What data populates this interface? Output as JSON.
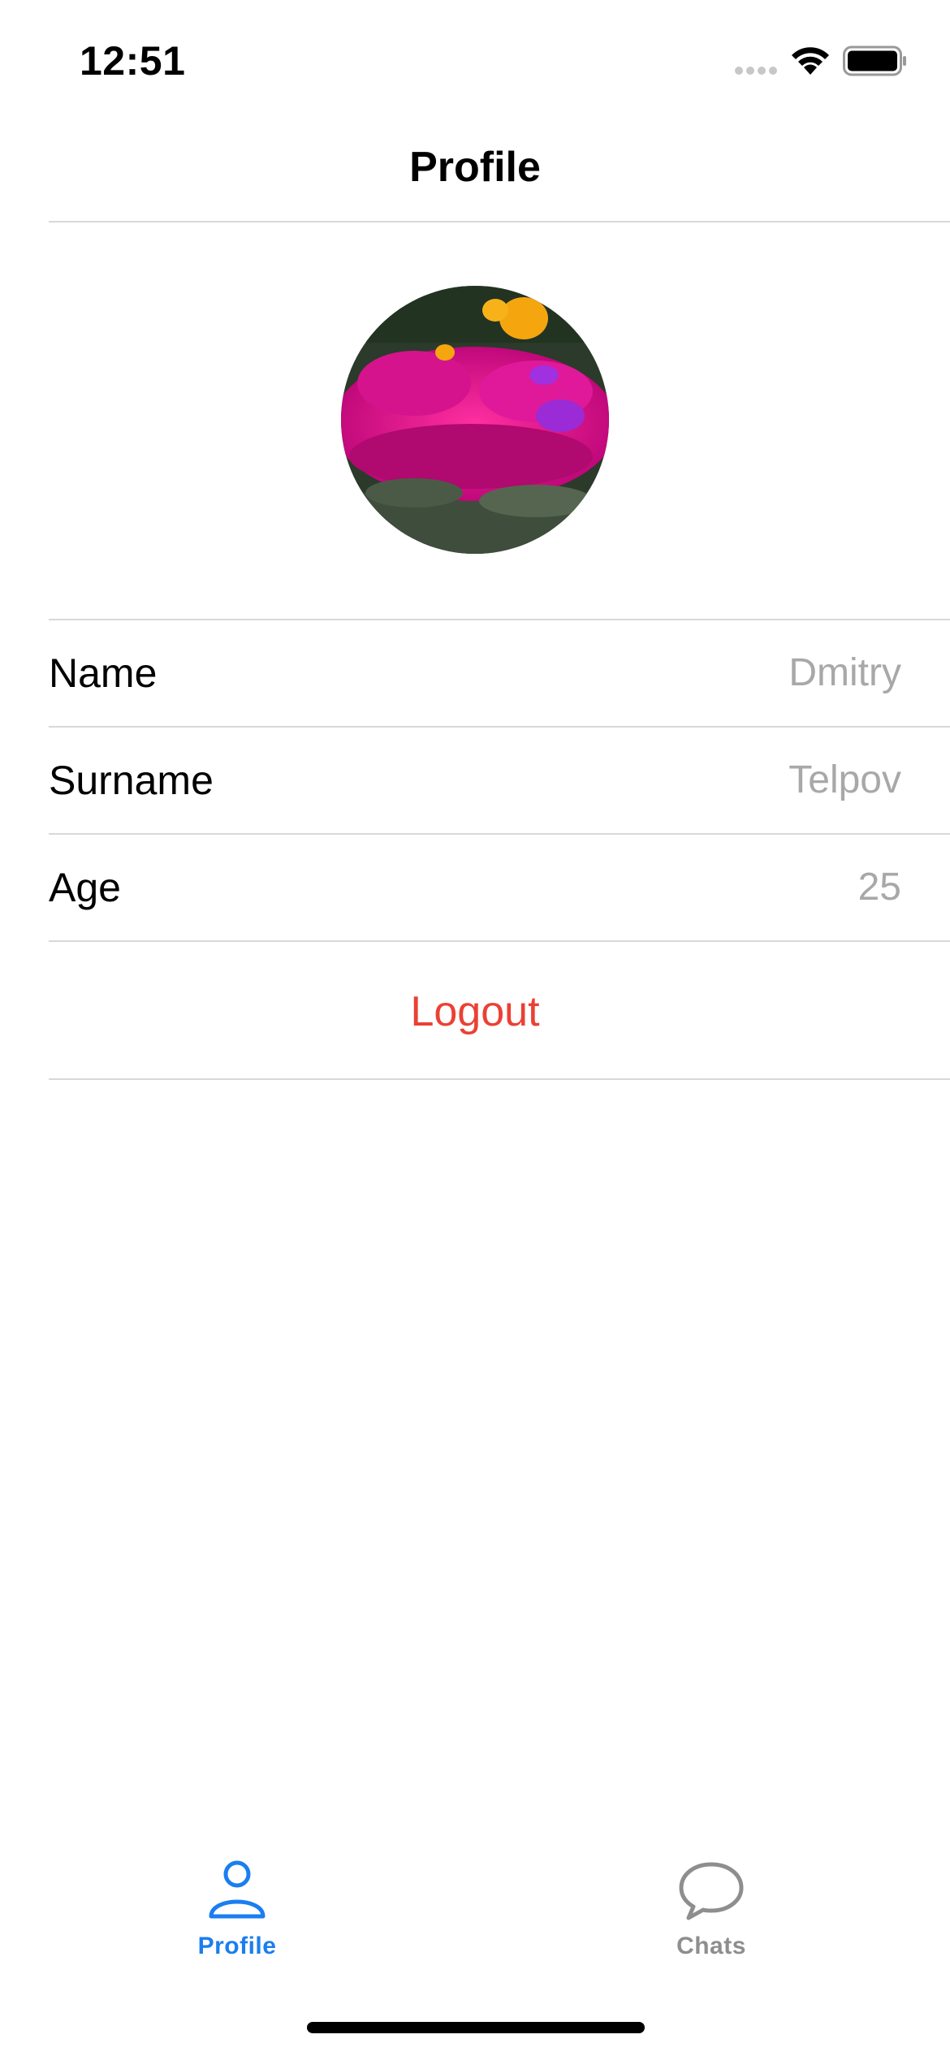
{
  "status_bar": {
    "time": "12:51",
    "icons": [
      "signal-icon",
      "wifi-icon",
      "battery-icon"
    ]
  },
  "nav": {
    "title": "Profile"
  },
  "profile": {
    "avatar_icon": "avatar-flowers-photo",
    "fields": [
      {
        "label": "Name",
        "value": "Dmitry"
      },
      {
        "label": "Surname",
        "value": "Telpov"
      },
      {
        "label": "Age",
        "value": "25"
      }
    ],
    "logout_label": "Logout"
  },
  "tab_bar": {
    "tabs": [
      {
        "label": "Profile",
        "icon": "person-icon",
        "active": true
      },
      {
        "label": "Chats",
        "icon": "chat-bubble-icon",
        "active": false
      }
    ]
  },
  "colors": {
    "accent": "#1a7ef0",
    "destructive": "#eb4034",
    "secondary_text": "#a8a8a8",
    "inactive_tab": "#8e8e8e",
    "separator": "#d8d8d8"
  }
}
